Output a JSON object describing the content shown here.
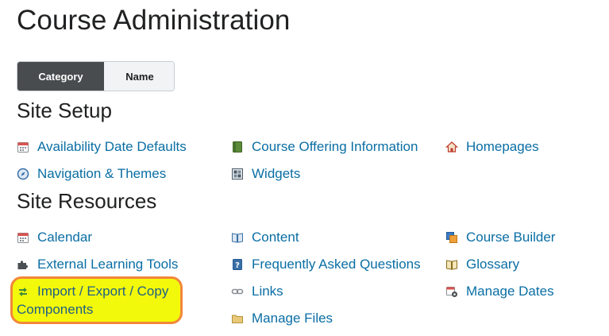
{
  "page": {
    "title": "Course Administration"
  },
  "view_toggle": {
    "category_label": "Category",
    "name_label": "Name",
    "selected": "Category"
  },
  "sections": {
    "site_setup": {
      "title": "Site Setup",
      "items": {
        "availability_date_defaults": "Availability Date Defaults",
        "course_offering_information": "Course Offering Information",
        "homepages": "Homepages",
        "navigation_themes": "Navigation & Themes",
        "widgets": "Widgets"
      }
    },
    "site_resources": {
      "title": "Site Resources",
      "items": {
        "calendar": "Calendar",
        "content": "Content",
        "course_builder": "Course Builder",
        "external_learning_tools": "External Learning Tools",
        "faq": "Frequently Asked Questions",
        "glossary": "Glossary",
        "import_export_copy_line1": "Import / Export / Copy",
        "import_export_copy_line2": "Components",
        "links": "Links",
        "manage_dates": "Manage Dates",
        "manage_files": "Manage Files"
      }
    }
  },
  "colors": {
    "link": "#0a6ea4",
    "toggle_active_bg": "#494c4e",
    "highlight_fill": "#f3f90a",
    "highlight_border": "#f2873a"
  },
  "icons": {
    "availability_date_defaults": "calendar-icon",
    "course_offering_information": "book-icon",
    "homepages": "home-icon",
    "navigation_themes": "compass-icon",
    "widgets": "widgets-grid-icon",
    "calendar": "calendar-icon",
    "content": "open-book-icon",
    "course_builder": "course-builder-icon",
    "external_learning_tools": "puzzle-icon",
    "faq": "faq-icon",
    "glossary": "glossary-book-icon",
    "import_export_copy": "import-export-arrows-icon",
    "links": "chain-link-icon",
    "manage_dates": "calendar-gear-icon",
    "manage_files": "folder-icon"
  }
}
